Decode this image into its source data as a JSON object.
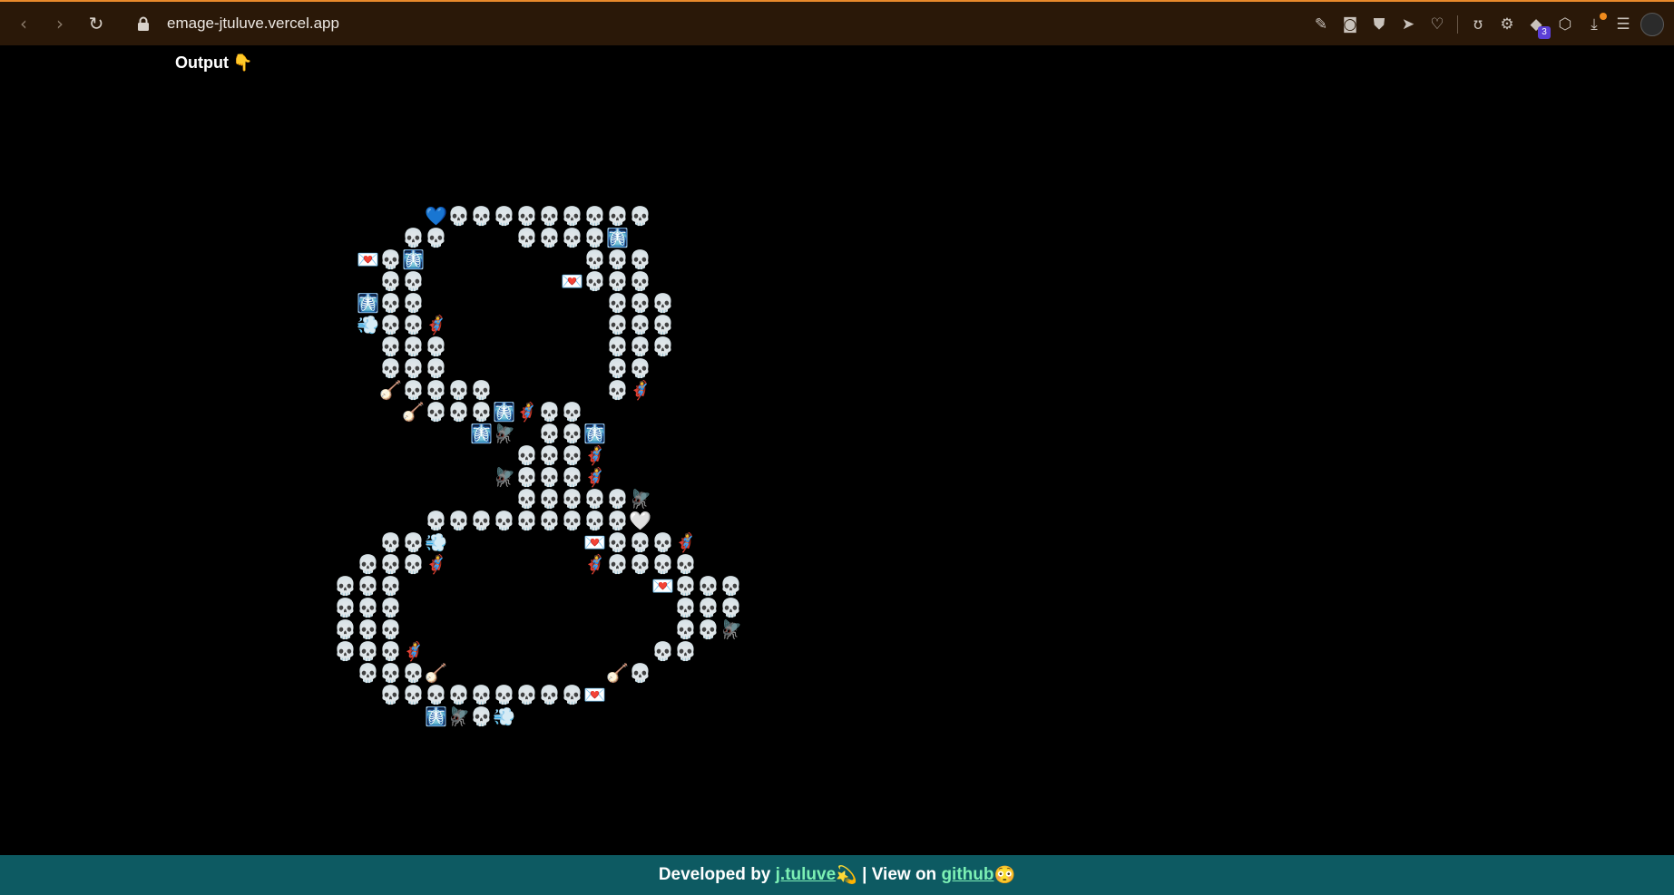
{
  "browser": {
    "url": "emage-jtuluve.vercel.app",
    "back_icon": "‹",
    "forward_icon": "›",
    "reload_icon": "↻",
    "extensions": [
      {
        "name": "edit-icon",
        "glyph": "✎"
      },
      {
        "name": "camera-icon",
        "glyph": "◙"
      },
      {
        "name": "shield-icon",
        "glyph": "⛊"
      },
      {
        "name": "send-icon",
        "glyph": "➤"
      },
      {
        "name": "heart-icon",
        "glyph": "♡"
      },
      {
        "name": "extension-u-icon",
        "glyph": "ʊ"
      },
      {
        "name": "chip-icon",
        "glyph": "⚙"
      },
      {
        "name": "diamond-icon",
        "glyph": "◆",
        "badge": "3"
      },
      {
        "name": "cube-icon",
        "glyph": "⬡"
      },
      {
        "name": "download-icon",
        "glyph": "⤓"
      },
      {
        "name": "settings-sliders-icon",
        "glyph": "☰"
      }
    ]
  },
  "page": {
    "heading": "Output",
    "heading_emoji": "👇"
  },
  "emoji_art": {
    "background_emoji": "🛋",
    "skull": "💀",
    "mosaic": [
      "                                ",
      "                                ",
      "                                ",
      "                                ",
      "           BSSSSSSSSS           ",
      "          SS   SSSSN            ",
      "        HSN       SSS           ",
      "         SS      HSSS           ",
      "        NSS        SSS          ",
      "        CSSF       SSS          ",
      "        GSSS       SSS          ",
      "         SSS       SS           ",
      "         /SSSS    GSF           ",
      "          /SSSNFSS              ",
      "             NMGSSN             ",
      "               SSSF             ",
      "              MSSSF             ",
      "               SSSSSM           ",
      "           SSSSSSSSSW           ",
      "         SSC      HSSSF         ",
      "        SSSF      FSSSS         ",
      "       SSS           HSSS       ",
      "       SSS            SSS       ",
      "       SSS            SSM       ",
      "       SSSF          SS         ",
      "        SSS/       /S           ",
      "         SSSSSSSSSH             ",
      "           NMSCG                ",
      "                                ",
      "                                ",
      "                                ",
      "                                "
    ],
    "legend": {
      "S": "💀",
      "B": "💙",
      "W": "🤍",
      "N": "🩻",
      "H": "💌",
      "C": "💨",
      "F": "🦸",
      "G": "🕶",
      "/": "🪕",
      "M": "🪰"
    }
  },
  "footer": {
    "developed_by": "Developed by ",
    "author_link": "j.tuluve",
    "author_emoji": "💫",
    "separator": " | View on ",
    "github_link": "github",
    "github_emoji": "😳"
  }
}
